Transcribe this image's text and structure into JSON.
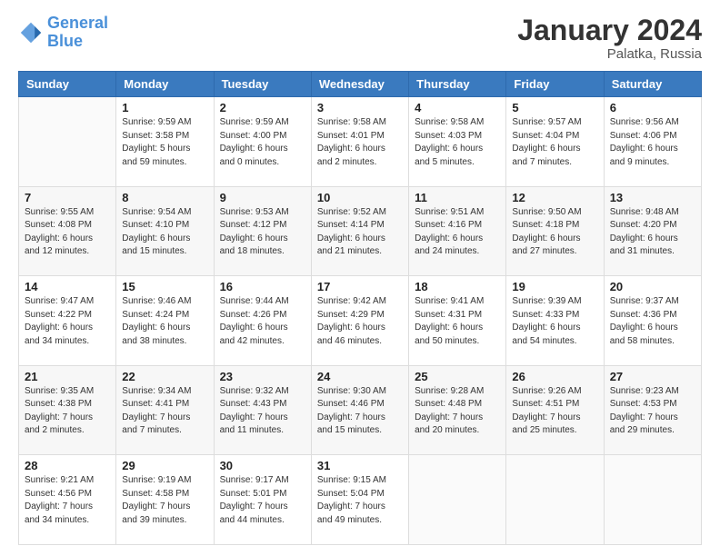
{
  "header": {
    "logo_general": "General",
    "logo_blue": "Blue",
    "title": "January 2024",
    "subtitle": "Palatka, Russia"
  },
  "columns": [
    "Sunday",
    "Monday",
    "Tuesday",
    "Wednesday",
    "Thursday",
    "Friday",
    "Saturday"
  ],
  "weeks": [
    [
      {
        "day": "",
        "info": ""
      },
      {
        "day": "1",
        "info": "Sunrise: 9:59 AM\nSunset: 3:58 PM\nDaylight: 5 hours\nand 59 minutes."
      },
      {
        "day": "2",
        "info": "Sunrise: 9:59 AM\nSunset: 4:00 PM\nDaylight: 6 hours\nand 0 minutes."
      },
      {
        "day": "3",
        "info": "Sunrise: 9:58 AM\nSunset: 4:01 PM\nDaylight: 6 hours\nand 2 minutes."
      },
      {
        "day": "4",
        "info": "Sunrise: 9:58 AM\nSunset: 4:03 PM\nDaylight: 6 hours\nand 5 minutes."
      },
      {
        "day": "5",
        "info": "Sunrise: 9:57 AM\nSunset: 4:04 PM\nDaylight: 6 hours\nand 7 minutes."
      },
      {
        "day": "6",
        "info": "Sunrise: 9:56 AM\nSunset: 4:06 PM\nDaylight: 6 hours\nand 9 minutes."
      }
    ],
    [
      {
        "day": "7",
        "info": "Sunrise: 9:55 AM\nSunset: 4:08 PM\nDaylight: 6 hours\nand 12 minutes."
      },
      {
        "day": "8",
        "info": "Sunrise: 9:54 AM\nSunset: 4:10 PM\nDaylight: 6 hours\nand 15 minutes."
      },
      {
        "day": "9",
        "info": "Sunrise: 9:53 AM\nSunset: 4:12 PM\nDaylight: 6 hours\nand 18 minutes."
      },
      {
        "day": "10",
        "info": "Sunrise: 9:52 AM\nSunset: 4:14 PM\nDaylight: 6 hours\nand 21 minutes."
      },
      {
        "day": "11",
        "info": "Sunrise: 9:51 AM\nSunset: 4:16 PM\nDaylight: 6 hours\nand 24 minutes."
      },
      {
        "day": "12",
        "info": "Sunrise: 9:50 AM\nSunset: 4:18 PM\nDaylight: 6 hours\nand 27 minutes."
      },
      {
        "day": "13",
        "info": "Sunrise: 9:48 AM\nSunset: 4:20 PM\nDaylight: 6 hours\nand 31 minutes."
      }
    ],
    [
      {
        "day": "14",
        "info": "Sunrise: 9:47 AM\nSunset: 4:22 PM\nDaylight: 6 hours\nand 34 minutes."
      },
      {
        "day": "15",
        "info": "Sunrise: 9:46 AM\nSunset: 4:24 PM\nDaylight: 6 hours\nand 38 minutes."
      },
      {
        "day": "16",
        "info": "Sunrise: 9:44 AM\nSunset: 4:26 PM\nDaylight: 6 hours\nand 42 minutes."
      },
      {
        "day": "17",
        "info": "Sunrise: 9:42 AM\nSunset: 4:29 PM\nDaylight: 6 hours\nand 46 minutes."
      },
      {
        "day": "18",
        "info": "Sunrise: 9:41 AM\nSunset: 4:31 PM\nDaylight: 6 hours\nand 50 minutes."
      },
      {
        "day": "19",
        "info": "Sunrise: 9:39 AM\nSunset: 4:33 PM\nDaylight: 6 hours\nand 54 minutes."
      },
      {
        "day": "20",
        "info": "Sunrise: 9:37 AM\nSunset: 4:36 PM\nDaylight: 6 hours\nand 58 minutes."
      }
    ],
    [
      {
        "day": "21",
        "info": "Sunrise: 9:35 AM\nSunset: 4:38 PM\nDaylight: 7 hours\nand 2 minutes."
      },
      {
        "day": "22",
        "info": "Sunrise: 9:34 AM\nSunset: 4:41 PM\nDaylight: 7 hours\nand 7 minutes."
      },
      {
        "day": "23",
        "info": "Sunrise: 9:32 AM\nSunset: 4:43 PM\nDaylight: 7 hours\nand 11 minutes."
      },
      {
        "day": "24",
        "info": "Sunrise: 9:30 AM\nSunset: 4:46 PM\nDaylight: 7 hours\nand 15 minutes."
      },
      {
        "day": "25",
        "info": "Sunrise: 9:28 AM\nSunset: 4:48 PM\nDaylight: 7 hours\nand 20 minutes."
      },
      {
        "day": "26",
        "info": "Sunrise: 9:26 AM\nSunset: 4:51 PM\nDaylight: 7 hours\nand 25 minutes."
      },
      {
        "day": "27",
        "info": "Sunrise: 9:23 AM\nSunset: 4:53 PM\nDaylight: 7 hours\nand 29 minutes."
      }
    ],
    [
      {
        "day": "28",
        "info": "Sunrise: 9:21 AM\nSunset: 4:56 PM\nDaylight: 7 hours\nand 34 minutes."
      },
      {
        "day": "29",
        "info": "Sunrise: 9:19 AM\nSunset: 4:58 PM\nDaylight: 7 hours\nand 39 minutes."
      },
      {
        "day": "30",
        "info": "Sunrise: 9:17 AM\nSunset: 5:01 PM\nDaylight: 7 hours\nand 44 minutes."
      },
      {
        "day": "31",
        "info": "Sunrise: 9:15 AM\nSunset: 5:04 PM\nDaylight: 7 hours\nand 49 minutes."
      },
      {
        "day": "",
        "info": ""
      },
      {
        "day": "",
        "info": ""
      },
      {
        "day": "",
        "info": ""
      }
    ]
  ]
}
